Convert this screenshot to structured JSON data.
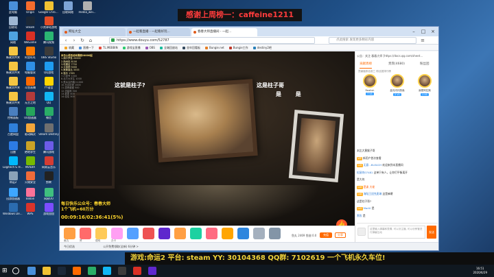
{
  "desktop_icons": [
    {
      "label": "此电脑",
      "color": "#4a90d9"
    },
    {
      "label": "Origin",
      "color": "#f56c2d"
    },
    {
      "label": "Google Chrome",
      "color": "#f1c232"
    },
    {
      "label": "回收网络",
      "color": "#7da4d6"
    },
    {
      "label": "media_wei...",
      "color": "#b0b0b0"
    },
    {
      "label": "回收站",
      "color": "#9fb7d3"
    },
    {
      "label": "Steam",
      "color": "#1b2838"
    },
    {
      "label": "小黑驿站游戏",
      "color": "#e44d26"
    },
    {
      "label": "网络",
      "color": "#4fa3e0"
    },
    {
      "label": "WeGame",
      "color": "#d93025"
    },
    {
      "label": "腾讯视频",
      "color": "#2bb673"
    },
    {
      "label": "新建文件夹",
      "color": "#f5c542"
    },
    {
      "label": "阿里旺旺",
      "color": "#ff7a00"
    },
    {
      "label": "OBS Studio",
      "color": "#3b3b3b"
    },
    {
      "label": "新建文件夹",
      "color": "#f5c542"
    },
    {
      "label": "电脑管家",
      "color": "#2f8fe6"
    },
    {
      "label": "QQ游戏",
      "color": "#1e9bf0"
    },
    {
      "label": "新建文件夹",
      "color": "#f5c542"
    },
    {
      "label": "斗鱼直播",
      "color": "#ff6a00"
    },
    {
      "label": "YY语音",
      "color": "#ffd400"
    },
    {
      "label": "新建文件夹",
      "color": "#f5c542"
    },
    {
      "label": "无主之地",
      "color": "#b23b3b"
    },
    {
      "label": "QQ",
      "color": "#12b7f5"
    },
    {
      "label": "控制面板",
      "color": "#4a7fbf"
    },
    {
      "label": "UU加速器",
      "color": "#26a65b"
    },
    {
      "label": "微信",
      "color": "#2aae67"
    },
    {
      "label": "百度网盘",
      "color": "#2f7fd9"
    },
    {
      "label": "驱动精灵",
      "color": "#f2a63a"
    },
    {
      "label": "Steam Destiny",
      "color": "#6f6f6f"
    },
    {
      "label": "迅雷",
      "color": "#2c7be5"
    },
    {
      "label": "绝地求生",
      "color": "#c9a227"
    },
    {
      "label": "腾讯游戏",
      "color": "#6c5ce7"
    },
    {
      "label": "Logitech G HUB",
      "color": "#00b8fc"
    },
    {
      "label": "NVIDIA",
      "color": "#76b900"
    },
    {
      "label": "网易云音乐",
      "color": "#d43c33"
    },
    {
      "label": "命运2",
      "color": "#8aa2b8"
    },
    {
      "label": "火绒安全",
      "color": "#ef6b3a"
    },
    {
      "label": "剪映",
      "color": "#222222"
    },
    {
      "label": "迅游加速器",
      "color": "#3ea7ff"
    },
    {
      "label": "Bilibili",
      "color": "#fb7299"
    },
    {
      "label": "网易UU",
      "color": "#3fbf7f"
    },
    {
      "label": "Windows Defender",
      "color": "#2b6cb0"
    },
    {
      "label": "WPS",
      "color": "#d9342b"
    },
    {
      "label": "游戏加加",
      "color": "#7c4dff"
    }
  ],
  "banner_top": "感谢上周榜一：caffeine1211",
  "browser": {
    "tabs": [
      {
        "label": "网址大全"
      },
      {
        "label": "一起看直播 - 一起看好玩..."
      },
      {
        "label": "春春大师直播间 - 一起..."
      }
    ],
    "url": "https://www.douyu.com/52787",
    "search_placeholder": "点此搜索 发现更多精彩内容",
    "bookmarks": [
      "收藏",
      "直播一下",
      "TL.MEBBIN",
      "游戏宝直播",
      "OBS",
      "全端回放站",
      "坐牢回看板",
      "Bungie.net",
      "Bungie工作",
      "destiny2吧"
    ]
  },
  "video": {
    "caption_left": "这就是柱子?",
    "caption_right": "这是柱子哥",
    "caption_sub": "是 是",
    "rank_title": "本日心得活动本周榜20000起",
    "rank_items": [
      "1.偶尔梦鱼 20000",
      "2.杨树枝 8100",
      "3.哈撒给 7732",
      "4.大猫团 5000",
      "5.蛋黄南瓜 3333",
      "6.猫乐 1765",
      "7.小茶爷 1000",
      "8.北方大学生 1000",
      "9.是木瓜的路人1000",
      "10.无名玩家 1000",
      "11.游侠盛盛 500",
      "12.流星雨 500",
      "13.麦麦 400",
      "14.佳佳 300"
    ],
    "promo_line1": "每日快乐公众号：春春大师",
    "promo_line2": "1个飞机=60万分",
    "timer": "00:09:16/02:36:41(5%)"
  },
  "gift_bar": {
    "gifts": [
      {
        "label": "鱼丸",
        "color": "#ff9f43"
      },
      {
        "label": "赞",
        "color": "#ff6b6b"
      },
      {
        "label": "弱鸡",
        "color": "#feca57"
      },
      {
        "label": "办卡",
        "color": "#ff9ff3"
      },
      {
        "label": "飞机",
        "color": "#54a0ff"
      },
      {
        "label": "火箭",
        "color": "#ee5253"
      },
      {
        "label": "超级火箭",
        "color": "#5f27cd"
      },
      {
        "label": "666",
        "color": "#ff9f43"
      },
      {
        "label": "粉丝荧光棒",
        "color": "#1dd1a1"
      },
      {
        "label": "告白气球",
        "color": "#ff6b81"
      },
      {
        "label": "棒棒糖",
        "color": "#ffa502"
      },
      {
        "label": "稳",
        "color": "#2e86de"
      },
      {
        "label": "鱼翅",
        "color": "#a4b0be"
      },
      {
        "label": "背包",
        "color": "#8395a7"
      }
    ],
    "balance_text": "鱼丸 2469  鱼翅 0.0",
    "charge_label": "充值",
    "share_label": "分享"
  },
  "status_bar": {
    "left": "今日优选",
    "mid": "公开免费领取(全新) 6分钟 >"
  },
  "sidebar": {
    "notice": "公告：关注 春春大师 [https://docs.qq.com/sheet...",
    "tabs": [
      {
        "label": "贡献周榜"
      },
      {
        "label": "贵宾(4680)"
      },
      {
        "label": "粉丝团"
      }
    ],
    "subtitle": "贡献值排名前三 粉丝团排行榜",
    "fans": [
      {
        "name": "Reallsh",
        "level": "7 V1"
      },
      {
        "name": "金光闪闪的鱼",
        "level": "2 V1"
      },
      {
        "name": "我是阿拉斯",
        "level": "1 V1"
      }
    ],
    "chat": [
      {
        "badge": "",
        "name": "",
        "text": "本比大黄猴子哥",
        "hot": false
      },
      {
        "badge": "VIP",
        "name": "",
        "text": "新用户首次查看",
        "hot": false
      },
      {
        "badge": "Lv9",
        "name": "无意...BLEACH",
        "text": "欢迎来到本直播间",
        "hot": false
      },
      {
        "badge": "",
        "name": "松鼠的07481",
        "text": "这单只有人，让你们平衡离开",
        "hot": false
      },
      {
        "badge": "",
        "name": "",
        "text": "是大的",
        "hot": false
      },
      {
        "badge": "Lv6",
        "name": "",
        "text": "是诶 大佬",
        "hot": true
      },
      {
        "badge": "Lv8",
        "name": "海陆王班克麦琳",
        "text": "这是麻薯",
        "hot": false
      },
      {
        "badge": "",
        "name": "",
        "text": "这是柱子哥?",
        "hot": false
      },
      {
        "badge": "Lv5",
        "name": "Martil",
        "text": "是",
        "hot": false
      },
      {
        "badge": "",
        "name": "黑玫",
        "text": "是",
        "hot": false
      }
    ],
    "input_placeholder": "这里输入弹幕和表情, 可以@主播, 可以@房管进行弹幕互动",
    "send_label": "发送"
  },
  "banner_bottom": "游戏:命运2 平台: steam YY: 30104368 QQ群: 7102619 一个飞机永久车位!",
  "taskbar": {
    "apps": [
      "#4a90d9",
      "#f1c232",
      "#1b2838",
      "#ff6a00",
      "#2aae67",
      "#12b7f5",
      "#3b3b3b",
      "#d93025",
      "#5f27cd"
    ],
    "time": "16:51",
    "date": "2020/6/29"
  }
}
